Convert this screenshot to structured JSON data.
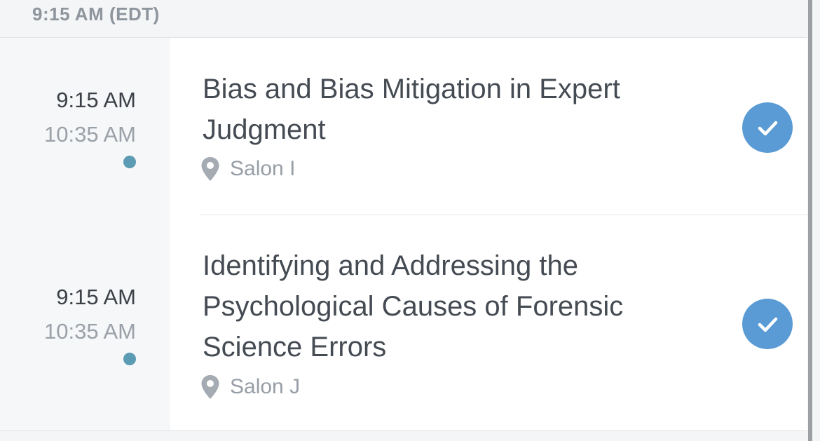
{
  "section": {
    "header": "9:15 AM (EDT)"
  },
  "sessions": [
    {
      "start": "9:15 AM",
      "end": "10:35 AM",
      "title_lines": [
        "Bias and Bias Mitigation in Expert",
        "Judgment"
      ],
      "location": "Salon I",
      "added": true
    },
    {
      "start": "9:15 AM",
      "end": "10:35 AM",
      "title_lines": [
        "Identifying and Addressing the",
        "Psychological Causes of Forensic",
        "Science Errors"
      ],
      "location": "Salon J",
      "added": true
    }
  ],
  "icons": {
    "location": "map-pin-icon",
    "added": "checkmark-icon"
  },
  "colors": {
    "accent": "#5a9bd5",
    "dot": "#5b9bb3",
    "title": "#454b53",
    "muted": "#979ea6"
  }
}
